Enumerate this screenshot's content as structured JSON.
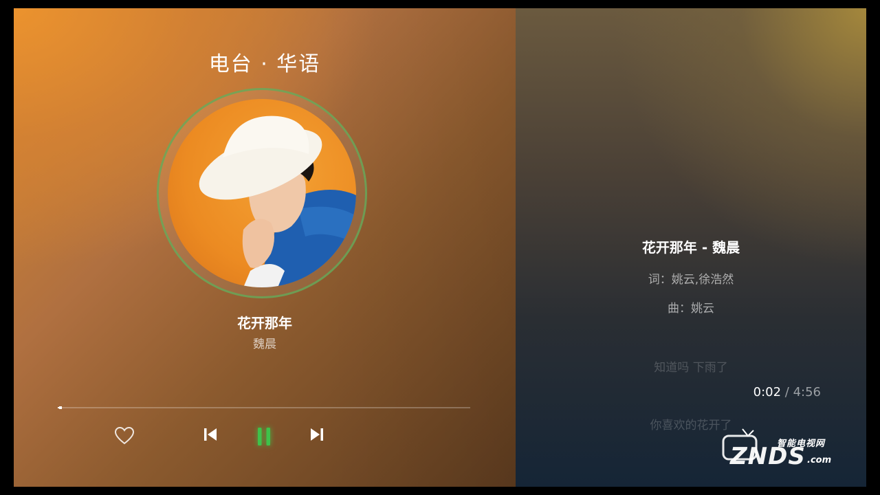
{
  "station": {
    "title": "电台 · 华语"
  },
  "now_playing": {
    "title": "花开那年",
    "artist": "魏晨",
    "cover_icon": "album-cover-artist-in-white-hat",
    "elapsed": "0:02",
    "separator": " / ",
    "duration": "4:56",
    "progress": 0.007
  },
  "controls": {
    "like_icon": "heart-outline-icon",
    "prev_icon": "skip-previous-icon",
    "pause_icon": "pause-icon",
    "next_icon": "skip-next-icon",
    "accent": "#3ec24a"
  },
  "lyrics": {
    "header": "花开那年 - 魏晨",
    "lines": [
      "词：姚云,徐浩然",
      "曲：姚云",
      "知道吗 下雨了",
      "你喜欢的花开了"
    ]
  },
  "watermark": {
    "top": "智能电视网",
    "main": "ZNDS",
    "suffix": ".com"
  }
}
